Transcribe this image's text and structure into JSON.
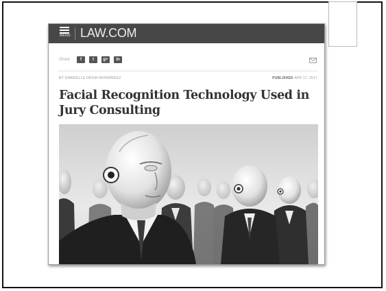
{
  "site": {
    "logo_text": "LAW.COM",
    "menu_label": "MENU"
  },
  "share": {
    "label": "Share",
    "icons": [
      {
        "name": "facebook-icon",
        "glyph": "f"
      },
      {
        "name": "twitter-icon",
        "glyph": "t"
      },
      {
        "name": "google-plus-icon",
        "glyph": "g+"
      },
      {
        "name": "linkedin-icon",
        "glyph": "in"
      }
    ],
    "email_icon": "mail-icon"
  },
  "article": {
    "byline": "BY GABRIELLE ORUM HERNÁNDEZ",
    "published_label": "PUBLISHED",
    "published_date": "APR 17, 2017",
    "headline": "Facial Recognition Technology Used in Jury Consulting"
  },
  "colors": {
    "header_bg": "#474747",
    "frame": "#111111"
  }
}
